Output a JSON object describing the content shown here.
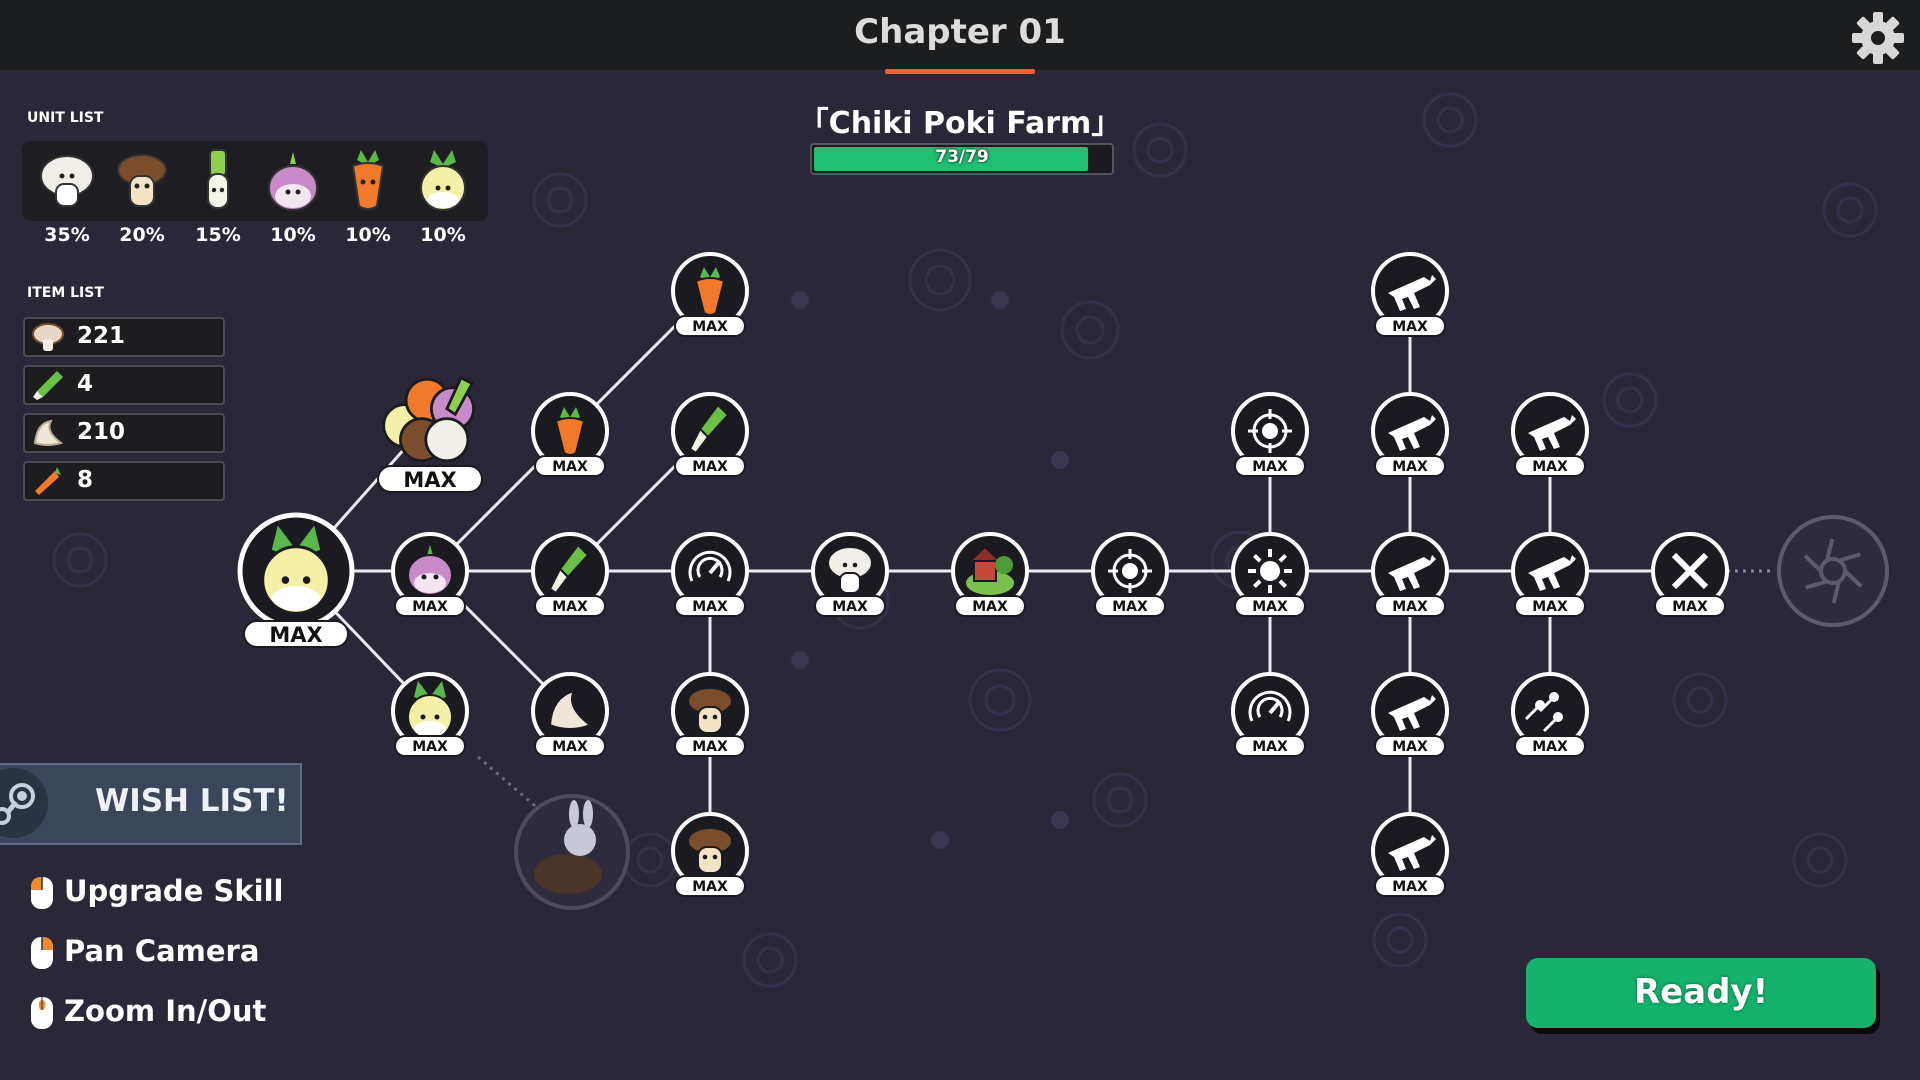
{
  "header": {
    "chapter_title": "Chapter 01",
    "settings_icon": "gear-icon"
  },
  "stage": {
    "name": "「Chiki Poki Farm」",
    "progress_text": "73/79",
    "progress_fraction": 0.924
  },
  "unit_list": {
    "label": "UNIT LIST",
    "units": [
      {
        "name": "mushroom-white",
        "percent": "35%"
      },
      {
        "name": "mushroom-brown",
        "percent": "20%"
      },
      {
        "name": "leek",
        "percent": "15%"
      },
      {
        "name": "onion",
        "percent": "10%"
      },
      {
        "name": "carrot",
        "percent": "10%"
      },
      {
        "name": "turnip",
        "percent": "10%"
      }
    ]
  },
  "item_list": {
    "label": "ITEM LIST",
    "items": [
      {
        "icon": "mushroom-icon",
        "value": "221"
      },
      {
        "icon": "leek-icon",
        "value": "4"
      },
      {
        "icon": "garlic-icon",
        "value": "210"
      },
      {
        "icon": "carrot-icon",
        "value": "8"
      }
    ]
  },
  "skill_tree": {
    "max_label": "MAX"
  },
  "wish_list": {
    "label": "WISH LIST!",
    "icon": "steam-icon"
  },
  "controls": [
    {
      "label": "Upgrade Skill",
      "icon": "mouse-left-icon"
    },
    {
      "label": "Pan Camera",
      "icon": "mouse-right-icon"
    },
    {
      "label": "Zoom In/Out",
      "icon": "mouse-wheel-icon"
    }
  ],
  "ready_button": {
    "label": "Ready!"
  },
  "colors": {
    "accent_orange": "#e8623a",
    "progress_green": "#1fc071",
    "ready_green": "#14b26b",
    "background": "#2a2838"
  }
}
